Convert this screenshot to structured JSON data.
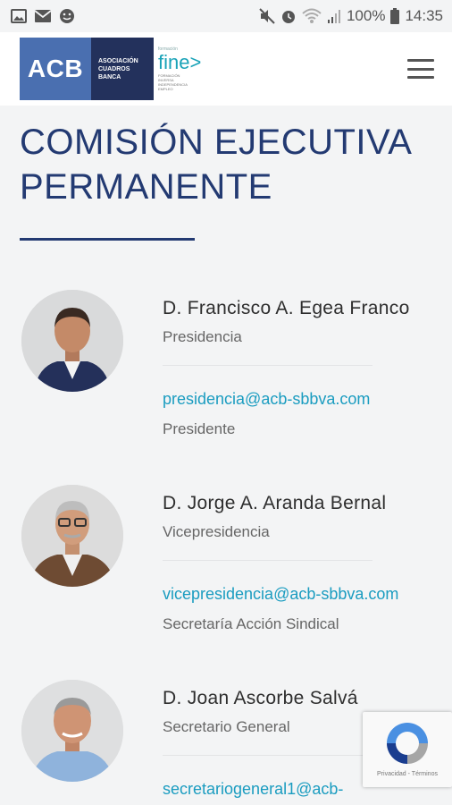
{
  "status_bar": {
    "battery": "100%",
    "time": "14:35"
  },
  "header": {
    "logo_acb": "ACB",
    "logo_lines": [
      "ASOCIACIÓN",
      "CUADROS",
      "BANCA"
    ],
    "logo_fine_small": "formación",
    "logo_fine": "fine>",
    "logo_fine_sub": [
      "FORMACIÓN",
      "INVERSA",
      "INDEPENDENCIA",
      "EMPLEO"
    ]
  },
  "page": {
    "title": "COMISIÓN EJECUTIVA PERMANENTE"
  },
  "members": [
    {
      "name": "D. Francisco A. Egea Franco",
      "role": "Presidencia",
      "email": "presidencia@acb-sbbva.com",
      "job": "Presidente"
    },
    {
      "name": "D. Jorge A. Aranda Bernal",
      "role": "Vicepresidencia",
      "email": "vicepresidencia@acb-sbbva.com",
      "job": "Secretaría Acción Sindical"
    },
    {
      "name": "D. Joan Ascorbe Salvá",
      "role": "Secretario General",
      "email": "secretariogeneral1@acb-",
      "job": ""
    }
  ],
  "recaptcha": {
    "text": "Privacidad - Términos"
  },
  "colors": {
    "accent": "#233a72",
    "link": "#1a9cc0",
    "logo_blue": "#4a6fb0",
    "logo_dark": "#23315c",
    "fine": "#1aa3b8"
  }
}
